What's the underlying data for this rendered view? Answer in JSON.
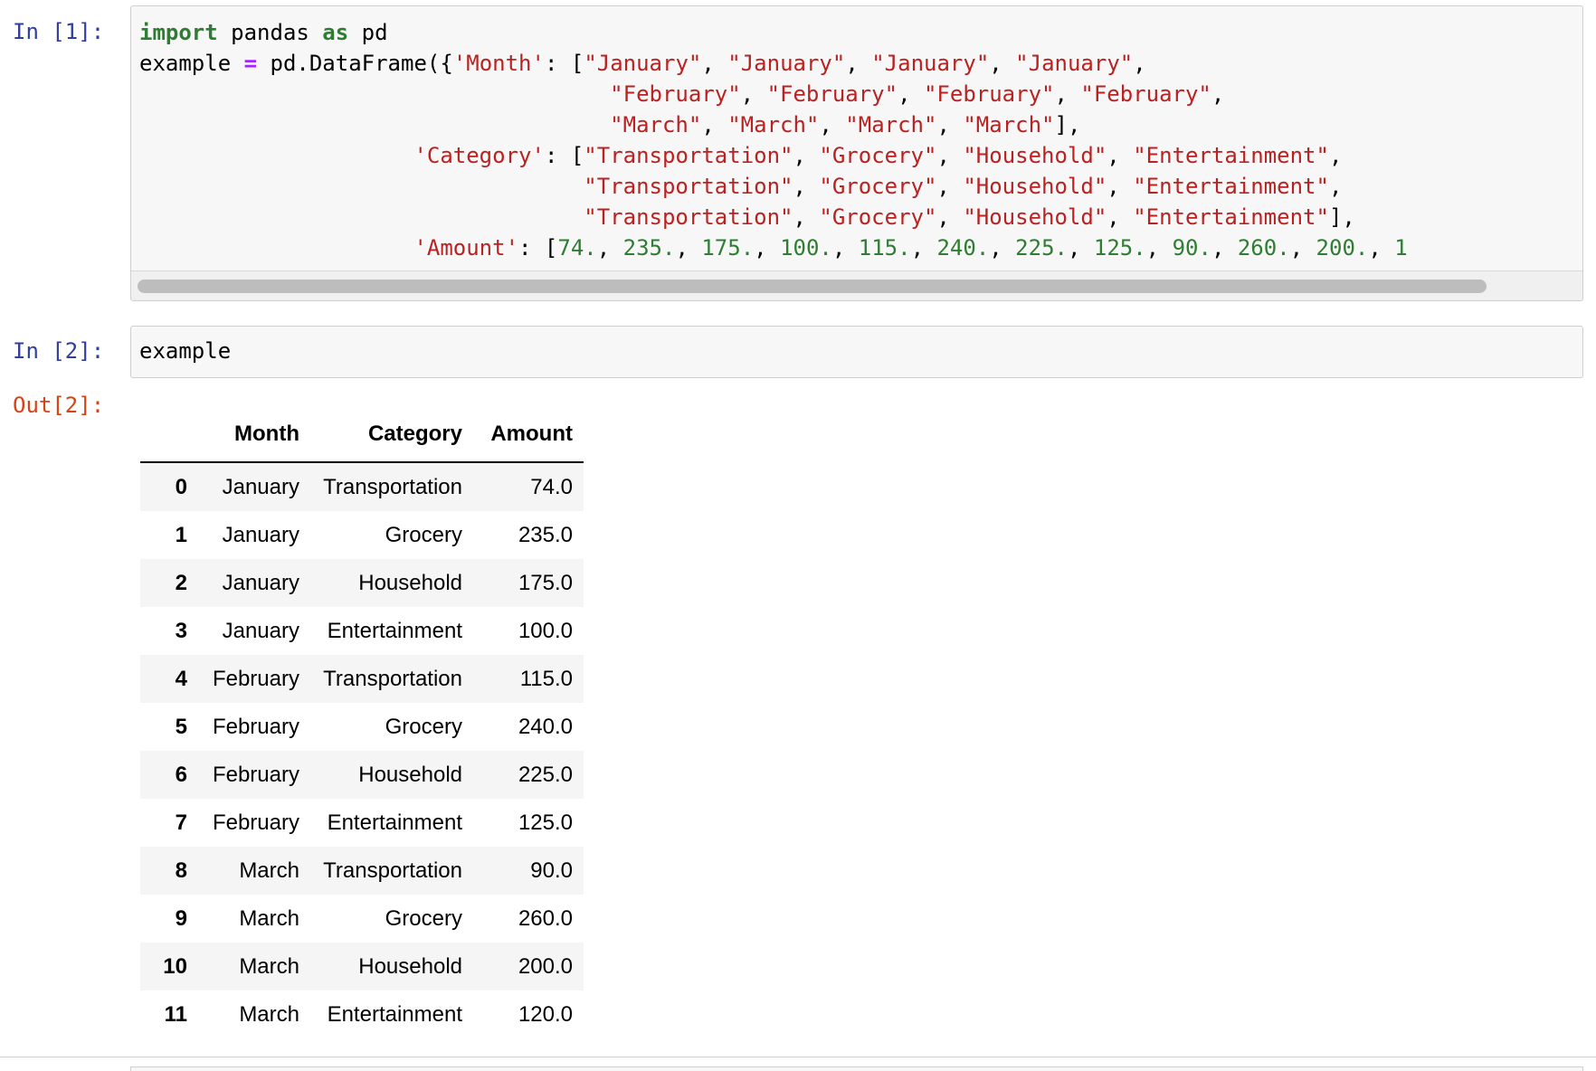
{
  "cell1": {
    "prompt": "In [1]:",
    "code": {
      "line1": {
        "kw1": "import",
        "mid": " pandas ",
        "kw2": "as",
        "end": " pd"
      },
      "line2": {
        "a": "example ",
        "op": "=",
        "b": " pd.DataFrame({",
        "key": "'Month'",
        "c": ": [",
        "s1": "\"January\"",
        "s2": "\"January\"",
        "s3": "\"January\"",
        "s4": "\"January\""
      },
      "line3": {
        "s1": "\"February\"",
        "s2": "\"February\"",
        "s3": "\"February\"",
        "s4": "\"February\""
      },
      "line4": {
        "s1": "\"March\"",
        "s2": "\"March\"",
        "s3": "\"March\"",
        "s4": "\"March\""
      },
      "line5": {
        "key": "'Category'",
        "s1": "\"Transportation\"",
        "s2": "\"Grocery\"",
        "s3": "\"Household\"",
        "s4": "\"Entertainment\""
      },
      "line6": {
        "s1": "\"Transportation\"",
        "s2": "\"Grocery\"",
        "s3": "\"Household\"",
        "s4": "\"Entertainment\""
      },
      "line7": {
        "s1": "\"Transportation\"",
        "s2": "\"Grocery\"",
        "s3": "\"Household\"",
        "s4": "\"Entertainment\""
      },
      "line8": {
        "key": "'Amount'",
        "n1": "74.",
        "n2": "235.",
        "n3": "175.",
        "n4": "100.",
        "n5": "115.",
        "n6": "240.",
        "n7": "225.",
        "n8": "125.",
        "n9": "90.",
        "n10": "260.",
        "n11": "200.",
        "n12": "1"
      }
    }
  },
  "cell2": {
    "prompt": "In [2]:",
    "code": "example",
    "out_prompt": "Out[2]:"
  },
  "dataframe": {
    "columns": [
      "Month",
      "Category",
      "Amount"
    ],
    "rows": [
      {
        "index": "0",
        "month": "January",
        "category": "Transportation",
        "amount": "74.0"
      },
      {
        "index": "1",
        "month": "January",
        "category": "Grocery",
        "amount": "235.0"
      },
      {
        "index": "2",
        "month": "January",
        "category": "Household",
        "amount": "175.0"
      },
      {
        "index": "3",
        "month": "January",
        "category": "Entertainment",
        "amount": "100.0"
      },
      {
        "index": "4",
        "month": "February",
        "category": "Transportation",
        "amount": "115.0"
      },
      {
        "index": "5",
        "month": "February",
        "category": "Grocery",
        "amount": "240.0"
      },
      {
        "index": "6",
        "month": "February",
        "category": "Household",
        "amount": "225.0"
      },
      {
        "index": "7",
        "month": "February",
        "category": "Entertainment",
        "amount": "125.0"
      },
      {
        "index": "8",
        "month": "March",
        "category": "Transportation",
        "amount": "90.0"
      },
      {
        "index": "9",
        "month": "March",
        "category": "Grocery",
        "amount": "260.0"
      },
      {
        "index": "10",
        "month": "March",
        "category": "Household",
        "amount": "200.0"
      },
      {
        "index": "11",
        "month": "March",
        "category": "Entertainment",
        "amount": "120.0"
      }
    ]
  }
}
